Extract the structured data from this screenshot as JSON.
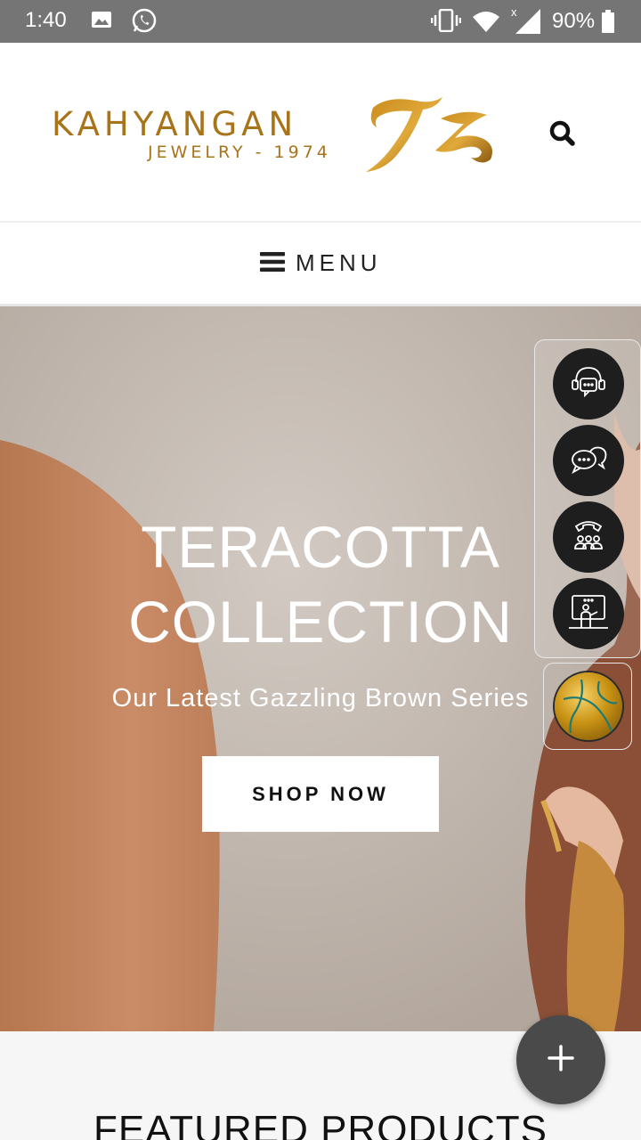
{
  "status_bar": {
    "time": "1:40",
    "battery": "90%",
    "icons": [
      "image-icon",
      "whatsapp-icon",
      "vibrate-icon",
      "wifi-icon",
      "signal-icon",
      "battery-icon"
    ]
  },
  "header": {
    "brand_name": "KAHYANGAN",
    "brand_tagline": "JEWELRY - 1974",
    "search_icon": "search-icon"
  },
  "nav": {
    "menu_label": "MENU"
  },
  "hero": {
    "title_line1": "TERACOTTA",
    "title_line2": "COLLECTION",
    "subtitle": "Our Latest Gazzling Brown Series",
    "cta_label": "SHOP NOW"
  },
  "contact_widget": {
    "buttons": [
      "support-agent-icon",
      "chat-icon",
      "call-group-icon",
      "presenter-icon"
    ],
    "ball_icon": "gold-ball-icon"
  },
  "featured": {
    "title": "FEATURED PRODUCTS"
  },
  "colors": {
    "brand_gold": "#a8741a",
    "status_bar": "#757575",
    "fab": "#4a4a4a"
  }
}
